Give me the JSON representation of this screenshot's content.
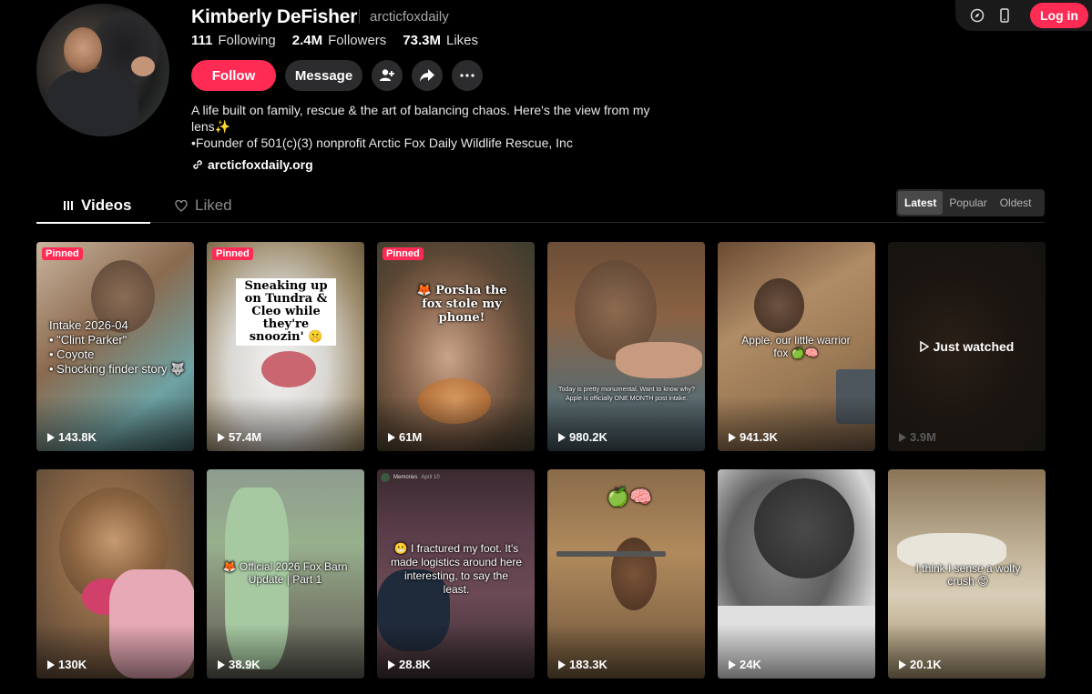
{
  "header": {
    "login_label": "Log in",
    "icons": [
      "compass-icon",
      "mobile-icon"
    ]
  },
  "profile": {
    "name": "Kimberly DeFisher",
    "handle": "arcticfoxdaily",
    "stats": {
      "following_value": "111",
      "following_label": "Following",
      "followers_value": "2.4M",
      "followers_label": "Followers",
      "likes_value": "73.3M",
      "likes_label": "Likes"
    },
    "actions": {
      "follow_label": "Follow",
      "message_label": "Message"
    },
    "bio_line1": "A life built on family, rescue & the art of balancing chaos. Here's the view from my lens✨",
    "bio_line2": "•Founder of 501(c)(3) nonprofit Arctic Fox Daily Wildlife Rescue, Inc",
    "link": "arcticfoxdaily.org"
  },
  "tabs": {
    "videos_label": "Videos",
    "liked_label": "Liked"
  },
  "sort": {
    "options": [
      "Latest",
      "Popular",
      "Oldest"
    ],
    "selected": "Latest"
  },
  "videos": [
    {
      "pinned": "Pinned",
      "views": "143.8K",
      "caption": "Intake 2026-04\n• \"Clint Parker\"\n• Coyote\n• Shocking finder story 🐺"
    },
    {
      "pinned": "Pinned",
      "views": "57.4M",
      "caption": "Sneaking up on Tundra & Cleo while they're snoozin' 🤫"
    },
    {
      "pinned": "Pinned",
      "views": "61M",
      "caption": "🦊 Porsha the fox stole my phone!"
    },
    {
      "pinned": "",
      "views": "980.2K",
      "caption": "Today is pretty monumental. Want to know why? Apple is officially ONE MONTH post intake."
    },
    {
      "pinned": "",
      "views": "941.3K",
      "caption": "Apple, our little warrior fox 🍏🧠"
    },
    {
      "pinned": "",
      "views": "3.9M",
      "caption": "Just watched"
    },
    {
      "pinned": "",
      "views": "130K",
      "caption": ""
    },
    {
      "pinned": "",
      "views": "38.9K",
      "caption": "🦊 Official 2026 Fox Barn Update | Part 1"
    },
    {
      "pinned": "",
      "views": "28.8K",
      "caption": "😬 I fractured my foot. It's made logistics around here interesting, to say the least.",
      "overlay_name": "Memories",
      "overlay_date": "April 10"
    },
    {
      "pinned": "",
      "views": "183.3K",
      "caption": "🍏🧠"
    },
    {
      "pinned": "",
      "views": "24K",
      "caption": ""
    },
    {
      "pinned": "",
      "views": "20.1K",
      "caption": "I think I sense a wolfy crush 😊"
    }
  ],
  "colors": {
    "accent": "#fe2c55",
    "background": "#000000",
    "button_secondary": "#2c2c2e"
  }
}
